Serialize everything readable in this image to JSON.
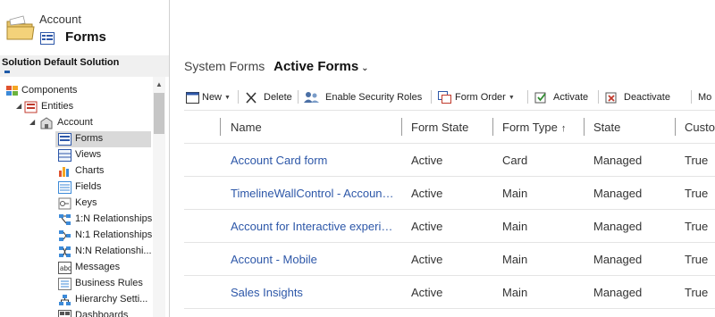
{
  "header": {
    "entity_name": "Account",
    "entity_sub": "Forms"
  },
  "solution": {
    "title": "Solution Default Solution"
  },
  "tree": {
    "items": [
      {
        "label": "Components",
        "icon": "components-icon"
      },
      {
        "label": "Entities",
        "icon": "entities-icon"
      },
      {
        "label": "Account",
        "icon": "account-entity-icon"
      },
      {
        "label": "Forms",
        "icon": "forms-icon"
      },
      {
        "label": "Views",
        "icon": "views-icon"
      },
      {
        "label": "Charts",
        "icon": "charts-icon"
      },
      {
        "label": "Fields",
        "icon": "fields-icon"
      },
      {
        "label": "Keys",
        "icon": "keys-icon"
      },
      {
        "label": "1:N Relationships",
        "icon": "relationship-icon"
      },
      {
        "label": "N:1 Relationships",
        "icon": "relationship-icon"
      },
      {
        "label": "N:N Relationshi...",
        "icon": "relationship-icon"
      },
      {
        "label": "Messages",
        "icon": "messages-icon"
      },
      {
        "label": "Business Rules",
        "icon": "business-rules-icon"
      },
      {
        "label": "Hierarchy Setti...",
        "icon": "hierarchy-icon"
      },
      {
        "label": "Dashboards",
        "icon": "dashboards-icon"
      }
    ]
  },
  "breadcrumb": {
    "label": "System Forms",
    "view": "Active Forms"
  },
  "toolbar": {
    "new": "New",
    "delete": "Delete",
    "security": "Enable Security Roles",
    "form_order": "Form Order",
    "activate": "Activate",
    "deactivate": "Deactivate",
    "more": "Mo"
  },
  "grid": {
    "columns": [
      "Name",
      "Form State",
      "Form Type",
      "State",
      "Custo"
    ],
    "rows": [
      {
        "name": "Account Card form",
        "form_state": "Active",
        "form_type": "Card",
        "state": "Managed",
        "custom": "True"
      },
      {
        "name": "TimelineWallControl - Account Main",
        "form_state": "Active",
        "form_type": "Main",
        "state": "Managed",
        "custom": "True"
      },
      {
        "name": "Account for Interactive experience",
        "form_state": "Active",
        "form_type": "Main",
        "state": "Managed",
        "custom": "True"
      },
      {
        "name": "Account - Mobile",
        "form_state": "Active",
        "form_type": "Main",
        "state": "Managed",
        "custom": "True"
      },
      {
        "name": "Sales Insights",
        "form_state": "Active",
        "form_type": "Main",
        "state": "Managed",
        "custom": "True"
      }
    ]
  },
  "colors": {
    "link": "#2d57a8",
    "selected_bg": "#d9d9d9"
  }
}
